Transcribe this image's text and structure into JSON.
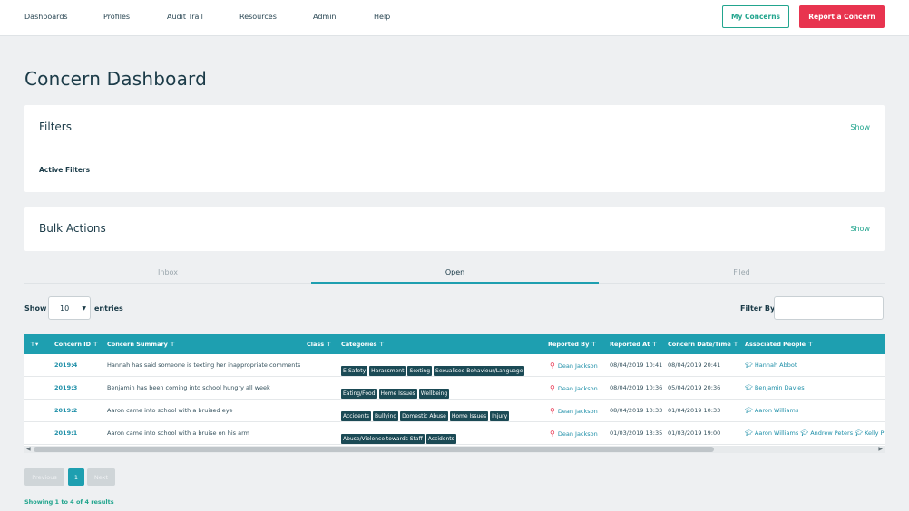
{
  "nav": {
    "items": [
      "Dashboards",
      "Profiles",
      "Audit Trail",
      "Resources",
      "Admin",
      "Help"
    ],
    "my_concerns": "My Concerns",
    "report_concern": "Report a Concern"
  },
  "page": {
    "title": "Concern Dashboard"
  },
  "filters": {
    "title": "Filters",
    "show": "Show",
    "active": "Active Filters"
  },
  "bulk": {
    "title": "Bulk Actions",
    "show": "Show"
  },
  "tabs": [
    "Inbox",
    "Open",
    "Filed"
  ],
  "length": {
    "show": "Show",
    "value": "10",
    "entries": "entries"
  },
  "filter_by": "Filter By",
  "table": {
    "headers": [
      "Concern ID",
      "Concern Summary",
      "Class",
      "Categories",
      "Reported By",
      "Reported At",
      "Concern Date/Time",
      "Associated People"
    ],
    "rows": [
      {
        "id": "2019:4",
        "summary": "Hannah has said someone is texting her inappropriate comments",
        "categories": [
          "E-Safety",
          "Harassment",
          "Sexting",
          "Sexualised Behaviour/Language"
        ],
        "reporter": "Dean Jackson",
        "reported_at": "08/04/2019 10:41",
        "concern_at": "08/04/2019 20:41",
        "people": [
          "Hannah Abbot"
        ]
      },
      {
        "id": "2019:3",
        "summary": "Benjamin has been coming into school hungry all week",
        "categories": [
          "Eating/Food",
          "Home Issues",
          "Wellbeing"
        ],
        "reporter": "Dean Jackson",
        "reported_at": "08/04/2019 10:36",
        "concern_at": "05/04/2019 20:36",
        "people": [
          "Benjamin Davies"
        ]
      },
      {
        "id": "2019:2",
        "summary": "Aaron came into school with a bruised eye",
        "categories": [
          "Accidents",
          "Bullying",
          "Domestic Abuse",
          "Home Issues",
          "Injury"
        ],
        "reporter": "Dean Jackson",
        "reported_at": "08/04/2019 10:33",
        "concern_at": "01/04/2019 10:33",
        "people": [
          "Aaron Williams"
        ]
      },
      {
        "id": "2019:1",
        "summary": "Aaron came into school with a bruise on his arm",
        "categories": [
          "Abuse/Violence towards Staff",
          "Accidents"
        ],
        "reporter": "Dean Jackson",
        "reported_at": "01/03/2019 13:35",
        "concern_at": "01/03/2019 19:00",
        "people": [
          "Aaron Williams",
          "Andrew Peters",
          "Kelly P"
        ]
      }
    ]
  },
  "pagination": {
    "previous": "Previous",
    "page": "1",
    "next": "Next"
  },
  "results": "Showing 1 to 4 of 4 results",
  "colors": {
    "teal": "#1e9fb0",
    "red": "#e8344f",
    "green": "#22a58e",
    "tag": "#1b4a55"
  }
}
